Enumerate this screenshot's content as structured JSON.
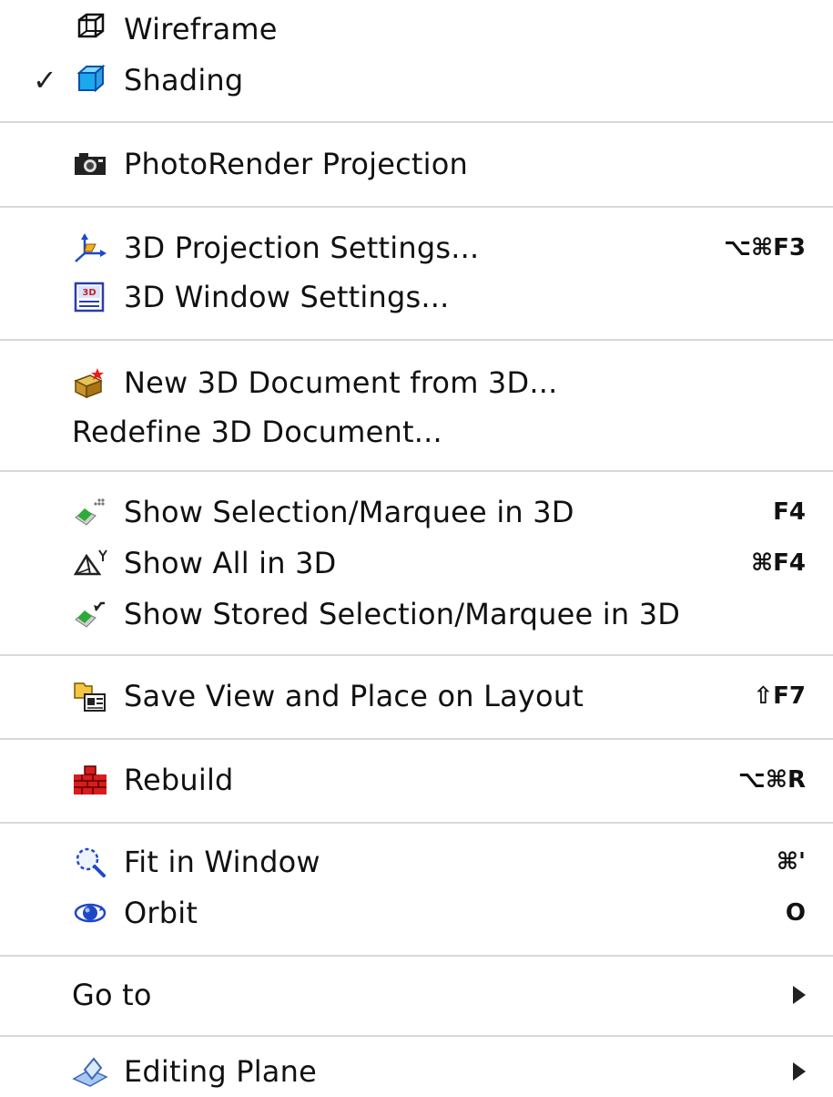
{
  "menu": {
    "items": [
      {
        "label": "Wireframe",
        "icon": "wireframe-icon",
        "shortcut": "",
        "checked": ""
      },
      {
        "label": "Shading",
        "icon": "shading-icon",
        "shortcut": "",
        "checked": "✓"
      },
      {
        "label": "PhotoRender Projection",
        "icon": "photorender-icon",
        "shortcut": ""
      },
      {
        "label": "3D Projection Settings...",
        "icon": "projection-settings-icon",
        "shortcut": "⌥⌘F3"
      },
      {
        "label": "3D Window Settings...",
        "icon": "window-settings-icon",
        "shortcut": ""
      },
      {
        "label": "New 3D Document from 3D...",
        "icon": "new-3d-document-icon",
        "shortcut": ""
      },
      {
        "label": "Redefine 3D Document...",
        "icon": "",
        "shortcut": ""
      },
      {
        "label": "Show Selection/Marquee in 3D",
        "icon": "show-selection-icon",
        "shortcut": "F4"
      },
      {
        "label": "Show All in 3D",
        "icon": "show-all-icon",
        "shortcut": "⌘F4"
      },
      {
        "label": "Show Stored Selection/Marquee in 3D",
        "icon": "show-stored-selection-icon",
        "shortcut": ""
      },
      {
        "label": "Save View and Place on Layout",
        "icon": "save-view-layout-icon",
        "shortcut": "⇧F7"
      },
      {
        "label": "Rebuild",
        "icon": "rebuild-icon",
        "shortcut": "⌥⌘R"
      },
      {
        "label": "Fit in Window",
        "icon": "fit-in-window-icon",
        "shortcut": "⌘'"
      },
      {
        "label": "Orbit",
        "icon": "orbit-icon",
        "shortcut": "O"
      },
      {
        "label": "Go to",
        "icon": "",
        "shortcut": "",
        "submenu": "submenu-arrow-icon"
      },
      {
        "label": "Editing Plane",
        "icon": "editing-plane-icon",
        "shortcut": "",
        "submenu": "submenu-arrow-icon"
      }
    ]
  }
}
